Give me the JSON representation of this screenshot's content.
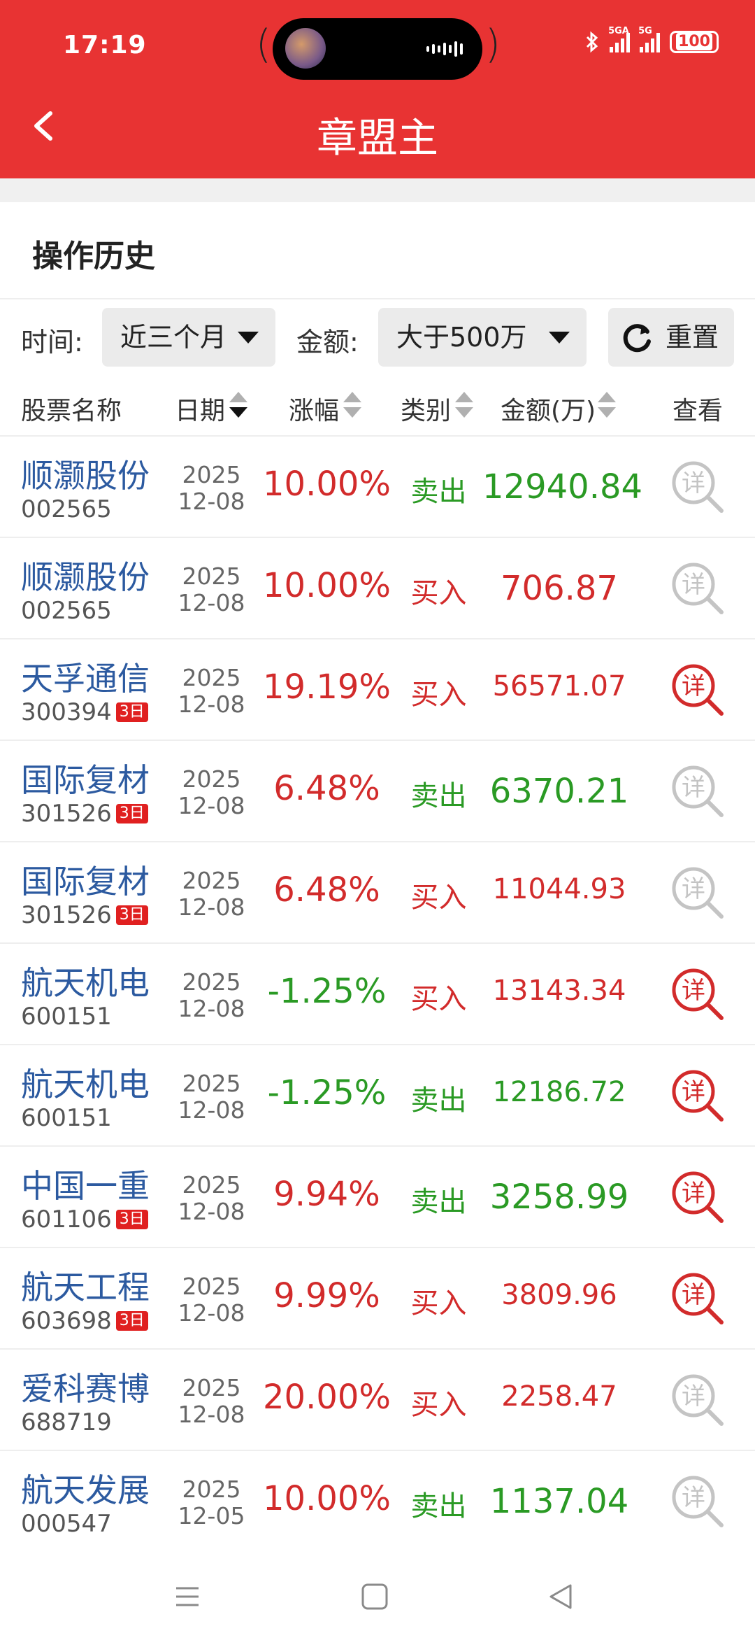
{
  "status_bar": {
    "time": "17:19",
    "network_1": "5GA",
    "network_2": "5G",
    "battery": "100"
  },
  "header": {
    "title": "章盟主"
  },
  "section": {
    "title": "操作历史"
  },
  "filters": {
    "time_label": "时间:",
    "time_value": "近三个月",
    "amount_label": "金额:",
    "amount_value": "大于500万",
    "reset_label": "重置"
  },
  "table": {
    "headers": {
      "name": "股票名称",
      "date": "日期",
      "change": "涨幅",
      "type": "类别",
      "amount": "金额(万)",
      "view": "查看"
    },
    "rows": [
      {
        "name": "顺灏股份",
        "code": "002565",
        "badge": "",
        "year": "2025",
        "md": "12-08",
        "change": "10.00%",
        "change_dir": "up",
        "type": "卖出",
        "amount": "12940.84",
        "amount_style": "sell-large",
        "detail_active": false
      },
      {
        "name": "顺灏股份",
        "code": "002565",
        "badge": "",
        "year": "2025",
        "md": "12-08",
        "change": "10.00%",
        "change_dir": "up",
        "type": "买入",
        "amount": "706.87",
        "amount_style": "buy-large",
        "detail_active": false
      },
      {
        "name": "天孚通信",
        "code": "300394",
        "badge": "3日",
        "year": "2025",
        "md": "12-08",
        "change": "19.19%",
        "change_dir": "up",
        "type": "买入",
        "amount": "56571.07",
        "amount_style": "buy",
        "detail_active": true
      },
      {
        "name": "国际复材",
        "code": "301526",
        "badge": "3日",
        "year": "2025",
        "md": "12-08",
        "change": "6.48%",
        "change_dir": "up",
        "type": "卖出",
        "amount": "6370.21",
        "amount_style": "sell-large",
        "detail_active": false
      },
      {
        "name": "国际复材",
        "code": "301526",
        "badge": "3日",
        "year": "2025",
        "md": "12-08",
        "change": "6.48%",
        "change_dir": "up",
        "type": "买入",
        "amount": "11044.93",
        "amount_style": "buy",
        "detail_active": false
      },
      {
        "name": "航天机电",
        "code": "600151",
        "badge": "",
        "year": "2025",
        "md": "12-08",
        "change": "-1.25%",
        "change_dir": "down",
        "type": "买入",
        "amount": "13143.34",
        "amount_style": "buy",
        "detail_active": true
      },
      {
        "name": "航天机电",
        "code": "600151",
        "badge": "",
        "year": "2025",
        "md": "12-08",
        "change": "-1.25%",
        "change_dir": "down",
        "type": "卖出",
        "amount": "12186.72",
        "amount_style": "sell",
        "detail_active": true
      },
      {
        "name": "中国一重",
        "code": "601106",
        "badge": "3日",
        "year": "2025",
        "md": "12-08",
        "change": "9.94%",
        "change_dir": "up",
        "type": "卖出",
        "amount": "3258.99",
        "amount_style": "sell-large",
        "detail_active": true
      },
      {
        "name": "航天工程",
        "code": "603698",
        "badge": "3日",
        "year": "2025",
        "md": "12-08",
        "change": "9.99%",
        "change_dir": "up",
        "type": "买入",
        "amount": "3809.96",
        "amount_style": "buy",
        "detail_active": true
      },
      {
        "name": "爱科赛博",
        "code": "688719",
        "badge": "",
        "year": "2025",
        "md": "12-08",
        "change": "20.00%",
        "change_dir": "up",
        "type": "买入",
        "amount": "2258.47",
        "amount_style": "buy",
        "detail_active": false
      },
      {
        "name": "航天发展",
        "code": "000547",
        "badge": "",
        "year": "2025",
        "md": "12-05",
        "change": "10.00%",
        "change_dir": "up",
        "type": "卖出",
        "amount": "1137.04",
        "amount_style": "sell-large",
        "detail_active": false
      }
    ],
    "detail_icon_glyph": "详"
  },
  "colors": {
    "accent": "#e83333",
    "up": "#d22b2b",
    "down": "#2a9a24",
    "link": "#2c5aa0",
    "inactive_icon": "#c4c4c4"
  },
  "icons": {
    "back": "back-arrow-icon",
    "reset": "refresh-icon",
    "detail": "magnifier-detail-icon",
    "nav": [
      "menu-icon",
      "home-square-icon",
      "back-triangle-icon"
    ]
  }
}
